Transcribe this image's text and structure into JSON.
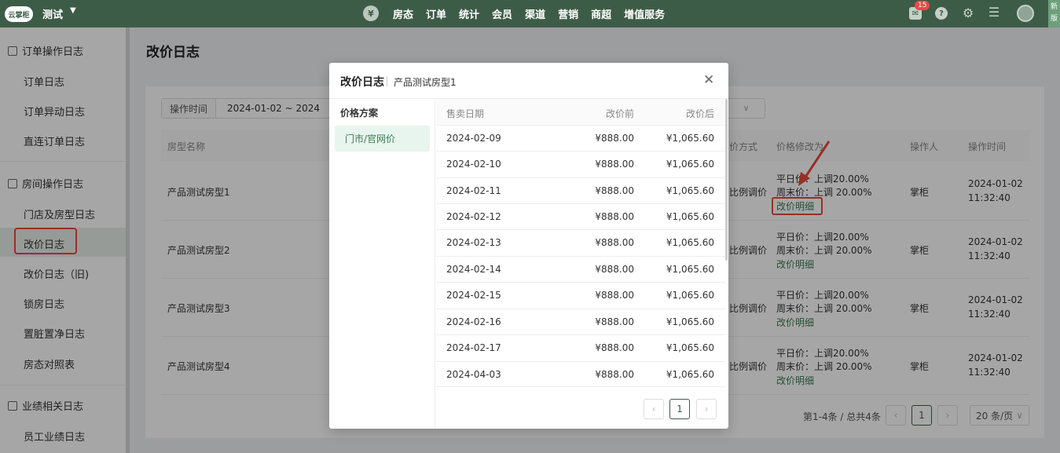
{
  "topbar": {
    "logo": "云掌柜",
    "store": "测试",
    "coin_icon": "yen-icon",
    "nav": [
      "房态",
      "订单",
      "统计",
      "会员",
      "渠道",
      "营销",
      "商超",
      "增值服务"
    ],
    "badge": "15",
    "new_tag": "新版"
  },
  "sidebar": {
    "groups": [
      {
        "label": "订单操作日志",
        "items": [
          "订单日志",
          "订单异动日志",
          "直连订单日志"
        ]
      },
      {
        "label": "房间操作日志",
        "items": [
          "门店及房型日志",
          "改价日志",
          "改价日志（旧)",
          "锁房日志",
          "置脏置净日志",
          "房态对照表"
        ]
      },
      {
        "label": "业绩相关日志",
        "items": [
          "员工业绩日志"
        ]
      }
    ]
  },
  "main": {
    "title": "改价日志",
    "filter": {
      "label": "操作时间",
      "date": "2024-01-02  ~  2024"
    },
    "columns": {
      "room_type": "房型名称",
      "method": "价方式",
      "change": "价格修改为",
      "operator": "操作人",
      "time": "操作时间"
    },
    "rows": [
      {
        "room_type": "产品测试房型1",
        "method": "比例调价",
        "weekday": "平日价：上调20.00%",
        "weekend": "周末价：上调 20.00%",
        "detail": "改价明细",
        "operator": "掌柜",
        "date": "2024-01-02",
        "clock": "11:32:40"
      },
      {
        "room_type": "产品测试房型2",
        "method": "比例调价",
        "weekday": "平日价：上调20.00%",
        "weekend": "周末价：上调 20.00%",
        "detail": "改价明细",
        "operator": "掌柜",
        "date": "2024-01-02",
        "clock": "11:32:40"
      },
      {
        "room_type": "产品测试房型3",
        "method": "比例调价",
        "weekday": "平日价：上调20.00%",
        "weekend": "周末价：上调 20.00%",
        "detail": "改价明细",
        "operator": "掌柜",
        "date": "2024-01-02",
        "clock": "11:32:40"
      },
      {
        "room_type": "产品测试房型4",
        "method": "比例调价",
        "weekday": "平日价：上调20.00%",
        "weekend": "周末价：上调 20.00%",
        "detail": "改价明细",
        "operator": "掌柜",
        "date": "2024-01-02",
        "clock": "11:32:40"
      }
    ],
    "pager": {
      "info": "第1-4条 / 总共4条",
      "page": "1",
      "size": "20 条/页"
    }
  },
  "modal": {
    "title": "改价日志",
    "subtitle": "产品测试房型1",
    "plan_label": "价格方案",
    "plan_item": "门市/官网价",
    "columns": {
      "date": "售卖日期",
      "before": "改价前",
      "after": "改价后"
    },
    "rows": [
      {
        "date": "2024-02-09",
        "before": "¥888.00",
        "after": "¥1,065.60"
      },
      {
        "date": "2024-02-10",
        "before": "¥888.00",
        "after": "¥1,065.60"
      },
      {
        "date": "2024-02-11",
        "before": "¥888.00",
        "after": "¥1,065.60"
      },
      {
        "date": "2024-02-12",
        "before": "¥888.00",
        "after": "¥1,065.60"
      },
      {
        "date": "2024-02-13",
        "before": "¥888.00",
        "after": "¥1,065.60"
      },
      {
        "date": "2024-02-14",
        "before": "¥888.00",
        "after": "¥1,065.60"
      },
      {
        "date": "2024-02-15",
        "before": "¥888.00",
        "after": "¥1,065.60"
      },
      {
        "date": "2024-02-16",
        "before": "¥888.00",
        "after": "¥1,065.60"
      },
      {
        "date": "2024-02-17",
        "before": "¥888.00",
        "after": "¥1,065.60"
      },
      {
        "date": "2024-04-03",
        "before": "¥888.00",
        "after": "¥1,065.60"
      }
    ],
    "page": "1"
  },
  "colors": {
    "brand": "#3d5c47",
    "accent_link": "#3d7a50",
    "highlight": "#e84a3a"
  }
}
